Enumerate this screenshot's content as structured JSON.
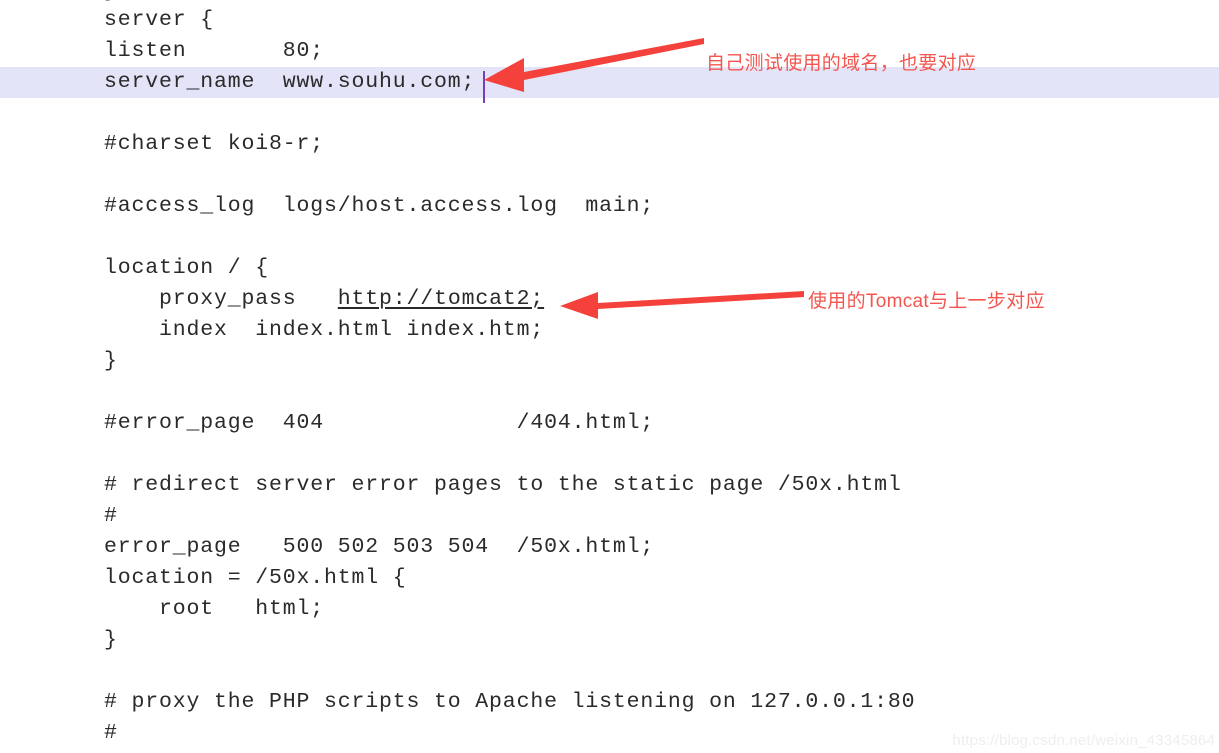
{
  "editor": {
    "top_clipped_text": "}",
    "caret": {
      "visible": true,
      "line_index": 2
    },
    "highlight_color": "#e4e4f8",
    "text_color": "#2a2a2a",
    "background_color": "#ffffff",
    "lines": [
      {
        "text": "server {",
        "highlight": false,
        "link": null
      },
      {
        "text": "listen       80;",
        "highlight": false,
        "link": null
      },
      {
        "text": "server_name  www.souhu.com;",
        "highlight": true,
        "link": null
      },
      {
        "text": "",
        "highlight": false,
        "link": null
      },
      {
        "text": "#charset koi8-r;",
        "highlight": false,
        "link": null
      },
      {
        "text": "",
        "highlight": false,
        "link": null
      },
      {
        "text": "#access_log  logs/host.access.log  main;",
        "highlight": false,
        "link": null
      },
      {
        "text": "",
        "highlight": false,
        "link": null
      },
      {
        "text": "location / {",
        "highlight": false,
        "link": null
      },
      {
        "text": "    proxy_pass   ",
        "highlight": false,
        "link": "http://tomcat2;"
      },
      {
        "text": "    index  index.html index.htm;",
        "highlight": false,
        "link": null
      },
      {
        "text": "}",
        "highlight": false,
        "link": null
      },
      {
        "text": "",
        "highlight": false,
        "link": null
      },
      {
        "text": "#error_page  404              /404.html;",
        "highlight": false,
        "link": null
      },
      {
        "text": "",
        "highlight": false,
        "link": null
      },
      {
        "text": "# redirect server error pages to the static page /50x.html",
        "highlight": false,
        "link": null
      },
      {
        "text": "#",
        "highlight": false,
        "link": null
      },
      {
        "text": "error_page   500 502 503 504  /50x.html;",
        "highlight": false,
        "link": null
      },
      {
        "text": "location = /50x.html {",
        "highlight": false,
        "link": null
      },
      {
        "text": "    root   html;",
        "highlight": false,
        "link": null
      },
      {
        "text": "}",
        "highlight": false,
        "link": null
      },
      {
        "text": "",
        "highlight": false,
        "link": null
      },
      {
        "text": "# proxy the PHP scripts to Apache listening on 127.0.0.1:80",
        "highlight": false,
        "link": null
      },
      {
        "text": "#",
        "highlight": false,
        "link": null
      }
    ]
  },
  "annotations": {
    "color": "#f4554f",
    "items": [
      {
        "text": "自己测试使用的域名，也要对应",
        "arrow": "left-pointing-red-arrow"
      },
      {
        "text": "使用的Tomcat与上一步对应",
        "arrow": "left-pointing-red-arrow"
      }
    ]
  },
  "watermark": {
    "text": "https://blog.csdn.net/weixin_43345864",
    "color": "#eeeeee"
  }
}
